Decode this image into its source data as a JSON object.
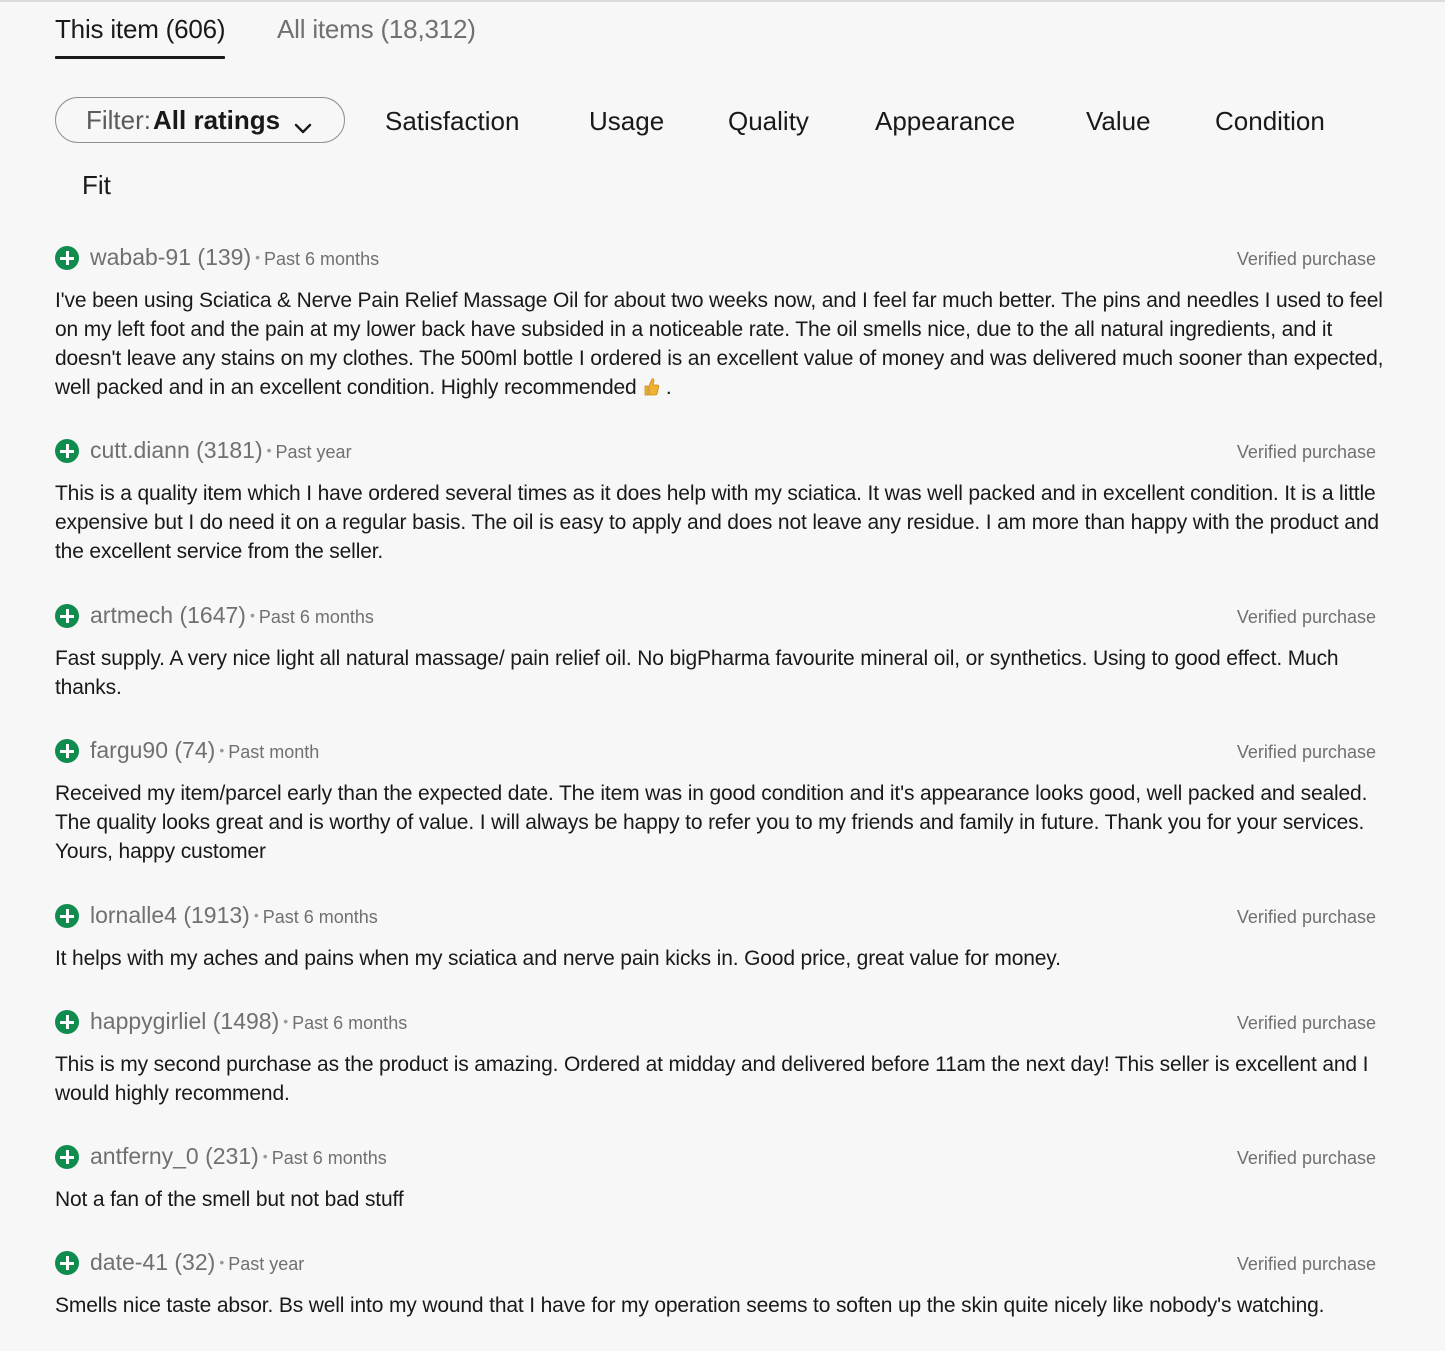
{
  "tabs": [
    {
      "label": "This item (606)",
      "active": true
    },
    {
      "label": "All items (18,312)",
      "active": false
    }
  ],
  "filter": {
    "prefix": "Filter:",
    "value": "All ratings",
    "icon": "chevron-down-icon"
  },
  "chips": [
    "Satisfaction",
    "Usage",
    "Quality",
    "Appearance",
    "Value",
    "Condition",
    "Fit"
  ],
  "colors": {
    "positive": "#118c4f",
    "text": "#191919",
    "muted": "#707070",
    "background": "#f7f7f7"
  },
  "reviews": [
    {
      "user": "wabab-91 (139)",
      "when": "Past 6 months",
      "badge": "Verified purchase",
      "text": "I've been using Sciatica & Nerve Pain Relief Massage Oil for about two weeks now, and I feel far much better. The pins and needles I used to feel on my left foot and the pain at my lower back have subsided in a noticeable rate. The oil smells nice, due to the all natural ingredients, and it doesn't leave any stains on my clothes. The 500ml bottle I ordered is an excellent value of money and was delivered much sooner than expected, well packed and in an excellent condition. Highly recommended",
      "text_end": " ."
    },
    {
      "user": "cutt.diann (3181)",
      "when": "Past year",
      "badge": "Verified purchase",
      "text": "This is a quality item which I have ordered several times as it does help with my sciatica. It was well packed and in excellent condition. It is a little expensive but I do need it on a regular basis. The oil is easy to apply and does not leave any residue. I am more than happy with the product and the excellent service from the seller."
    },
    {
      "user": "artmech (1647)",
      "when": "Past 6 months",
      "badge": "Verified purchase",
      "text": "Fast supply. A very nice light all natural massage/ pain relief oil. No bigPharma favourite mineral oil, or synthetics. Using to good effect. Much thanks."
    },
    {
      "user": "fargu90 (74)",
      "when": "Past month",
      "badge": "Verified purchase",
      "text": "Received my item/parcel early than the expected date. The item was in good condition and it's appearance looks good, well packed and sealed. The quality looks great and is worthy of value. I will always be happy to refer you to my friends and family in future. Thank you for your services. Yours, happy customer"
    },
    {
      "user": "lornalle4 (1913)",
      "when": "Past 6 months",
      "badge": "Verified purchase",
      "text": "It helps with my aches and pains when my sciatica and nerve pain kicks in. Good price, great value for money."
    },
    {
      "user": "happygirliel (1498)",
      "when": "Past 6 months",
      "badge": "Verified purchase",
      "text": "This is my second purchase as the product is amazing. Ordered at midday and delivered before 11am the next day! This seller is excellent and I would highly recommend."
    },
    {
      "user": "antferny_0 (231)",
      "when": "Past 6 months",
      "badge": "Verified purchase",
      "text": "Not a fan of the smell but not bad stuff"
    },
    {
      "user": "date-41 (32)",
      "when": "Past year",
      "badge": "Verified purchase",
      "text": "Smells nice taste absor. Bs well into my wound that I have for my operation seems to soften up the skin quite nicely like nobody's watching."
    }
  ]
}
